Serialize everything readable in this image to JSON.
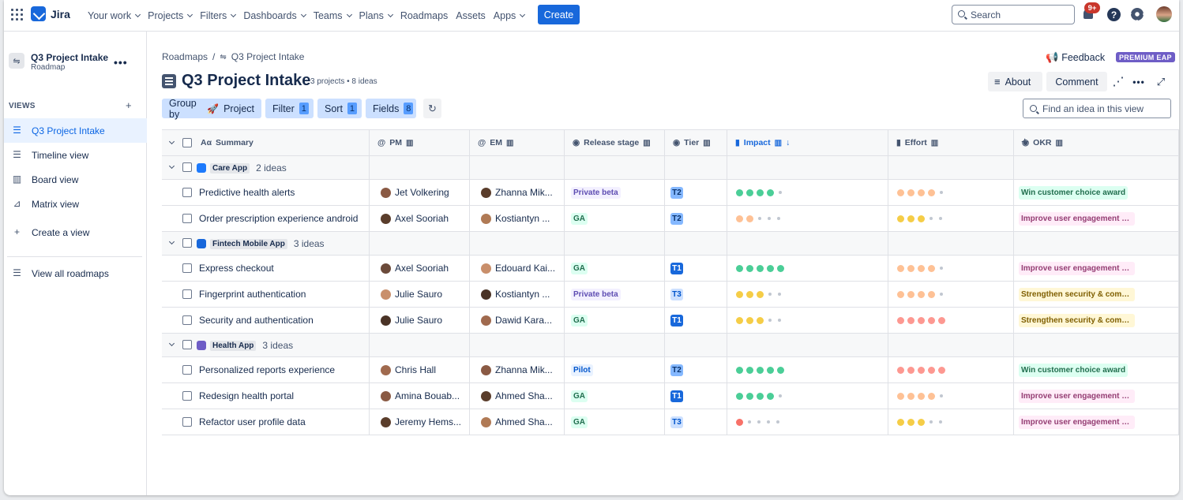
{
  "topnav": {
    "logo": "Jira",
    "items": [
      "Your work",
      "Projects",
      "Filters",
      "Dashboards",
      "Teams",
      "Plans",
      "Roadmaps",
      "Assets",
      "Apps"
    ],
    "create": "Create",
    "search_placeholder": "Search",
    "notifications": "9+",
    "help": "?"
  },
  "sidebar": {
    "title": "Q3 Project Intake",
    "subtitle": "Roadmap",
    "more": "•••",
    "views_label": "VIEWS",
    "views_add": "+",
    "views": [
      {
        "label": "Q3 Project Intake",
        "icon": "list-icon",
        "active": true
      },
      {
        "label": "Timeline view",
        "icon": "timeline-icon"
      },
      {
        "label": "Board view",
        "icon": "board-icon"
      },
      {
        "label": "Matrix view",
        "icon": "matrix-icon"
      },
      {
        "label": "Create a view",
        "icon": "plus-icon"
      }
    ],
    "view_all": "View all roadmaps"
  },
  "header": {
    "breadcrumb_root": "Roadmaps",
    "breadcrumb_sep": "/",
    "breadcrumb_current": "Q3 Project Intake",
    "feedback": "Feedback",
    "premium": "PREMIUM EAP",
    "title": "Q3 Project Intake",
    "meta": "3 projects • 8 ideas",
    "about": "About",
    "comment": "Comment"
  },
  "toolbar": {
    "group_by": "Group by",
    "group_value": "Project",
    "filter": "Filter",
    "filter_count": "1",
    "sort": "Sort",
    "sort_count": "1",
    "fields": "Fields",
    "fields_count": "8",
    "find_placeholder": "Find an idea in this view"
  },
  "columns": [
    "Summary",
    "PM",
    "EM",
    "Release stage",
    "Tier",
    "Impact",
    "Effort",
    "OKR"
  ],
  "colors": {
    "accent": "#1868db",
    "impact_green": "#4bce97",
    "impact_yellow": "#f5cd47",
    "impact_orange": "#fec195",
    "impact_red": "#f87168",
    "effort_orange": "#fec195",
    "effort_yellow": "#f5cd47",
    "effort_red": "#fd9891"
  },
  "groups": [
    {
      "name": "Care App",
      "count": "2 ideas",
      "icon_color": "#1d7afc",
      "rows": [
        {
          "summary": "Predictive health alerts",
          "pm": "Jet Volkering",
          "em": "Zhanna Mik...",
          "stage": "Private beta",
          "tier": "T2",
          "impact": 4,
          "impact_color": "impact_green",
          "effort": 4,
          "effort_color": "effort_orange",
          "okr": "Win customer choice award",
          "okr_type": "green"
        },
        {
          "summary": "Order prescription experience android",
          "pm": "Axel Sooriah",
          "em": "Kostiantyn ...",
          "stage": "GA",
          "tier": "T2",
          "impact": 2,
          "impact_color": "impact_orange",
          "effort": 3,
          "effort_color": "effort_yellow",
          "okr": "Improve user engagement a...",
          "okr_type": "pink"
        }
      ]
    },
    {
      "name": "Fintech Mobile App",
      "count": "3 ideas",
      "icon_color": "#1868db",
      "rows": [
        {
          "summary": "Express checkout",
          "pm": "Axel Sooriah",
          "em": "Edouard Kai...",
          "stage": "GA",
          "tier": "T1",
          "impact": 5,
          "impact_color": "impact_green",
          "effort": 4,
          "effort_color": "effort_orange",
          "okr": "Improve user engagement a...",
          "okr_type": "pink"
        },
        {
          "summary": "Fingerprint authentication",
          "pm": "Julie Sauro",
          "em": "Kostiantyn ...",
          "stage": "Private beta",
          "tier": "T3",
          "impact": 3,
          "impact_color": "impact_yellow",
          "effort": 4,
          "effort_color": "effort_orange",
          "okr": "Strengthen security & comp...",
          "okr_type": "yellow"
        },
        {
          "summary": "Security and authentication",
          "pm": "Julie Sauro",
          "em": "Dawid Kara...",
          "stage": "GA",
          "tier": "T1",
          "impact": 3,
          "impact_color": "impact_yellow",
          "effort": 5,
          "effort_color": "effort_red",
          "okr": "Strengthen security & comp...",
          "okr_type": "yellow"
        }
      ]
    },
    {
      "name": "Health App",
      "count": "3 ideas",
      "icon_color": "#6e5dc6",
      "rows": [
        {
          "summary": "Personalized reports experience",
          "pm": "Chris Hall",
          "em": "Zhanna Mik...",
          "stage": "Pilot",
          "tier": "T2",
          "impact": 5,
          "impact_color": "impact_green",
          "effort": 5,
          "effort_color": "effort_red",
          "okr": "Win customer choice award",
          "okr_type": "green"
        },
        {
          "summary": "Redesign health portal",
          "pm": "Amina Bouab...",
          "em": "Ahmed Sha...",
          "stage": "GA",
          "tier": "T1",
          "impact": 4,
          "impact_color": "impact_green",
          "effort": 4,
          "effort_color": "effort_orange",
          "okr": "Improve user engagement a...",
          "okr_type": "pink"
        },
        {
          "summary": "Refactor user profile data",
          "pm": "Jeremy Hems...",
          "em": "Ahmed Sha...",
          "stage": "GA",
          "tier": "T3",
          "impact": 1,
          "impact_color": "impact_red",
          "effort": 3,
          "effort_color": "effort_yellow",
          "okr": "Improve user engagement a...",
          "okr_type": "pink"
        }
      ]
    }
  ]
}
